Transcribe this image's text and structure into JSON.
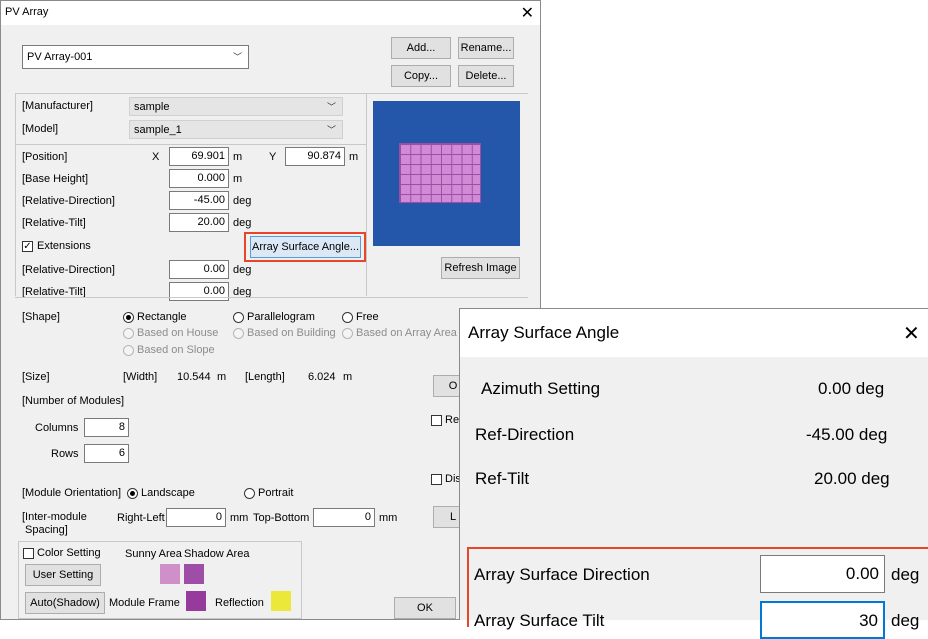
{
  "window": {
    "title": "PV Array",
    "close": "✕"
  },
  "array_select": {
    "value": "PV Array-001"
  },
  "buttons": {
    "add": "Add...",
    "rename": "Rename...",
    "copy": "Copy...",
    "delete": "Delete...",
    "array_surface_angle": "Array Surface Angle...",
    "refresh_image": "Refresh Image",
    "user_setting": "User Setting",
    "auto_shadow": "Auto(Shadow)",
    "ok": "OK",
    "o_partial": "O",
    "l_partial": "L"
  },
  "manufacturer": {
    "label": "[Manufacturer]",
    "value": "sample"
  },
  "model": {
    "label": "[Model]",
    "value": "sample_1"
  },
  "position": {
    "label": "[Position]",
    "x_label": "X",
    "x_value": "69.901",
    "x_unit": "m",
    "y_label": "Y",
    "y_value": "90.874",
    "y_unit": "m"
  },
  "base_height": {
    "label": "[Base Height]",
    "value": "0.000",
    "unit": "m"
  },
  "rel_direction": {
    "label": "[Relative-Direction]",
    "value": "-45.00",
    "unit": "deg"
  },
  "rel_tilt": {
    "label": "[Relative-Tilt]",
    "value": "20.00",
    "unit": "deg"
  },
  "extensions": {
    "label": "Extensions",
    "checked": true
  },
  "ext_rel_direction": {
    "label": "[Relative-Direction]",
    "value": "0.00",
    "unit": "deg"
  },
  "ext_rel_tilt": {
    "label": "[Relative-Tilt]",
    "value": "0.00",
    "unit": "deg"
  },
  "preview_colors": {
    "bg": "#2457a9",
    "module": "#d28ad6",
    "grid": "#9a4ea4"
  },
  "shape": {
    "label": "[Shape]",
    "rectangle": "Rectangle",
    "parallelogram": "Parallelogram",
    "free": "Free",
    "house": "Based on House",
    "building": "Based on Building",
    "array_area": "Based on Array Area",
    "slope": "Based on Slope"
  },
  "size": {
    "label": "[Size]",
    "width_label": "[Width]",
    "width_value": "10.544",
    "width_unit": "m",
    "length_label": "[Length]",
    "length_value": "6.024",
    "length_unit": "m"
  },
  "modules": {
    "label": "[Number of Modules]",
    "columns_label": "Columns",
    "columns_value": "8",
    "rows_label": "Rows",
    "rows_value": "6"
  },
  "partial_checks": {
    "ref": "Ref",
    "dis": "Dis"
  },
  "orientation": {
    "label": "[Module Orientation]",
    "landscape": "Landscape",
    "portrait": "Portrait"
  },
  "spacing": {
    "label_line1": "[Inter-module",
    "label_line2": "Spacing]",
    "rl_label": "Right-Left",
    "rl_value": "0",
    "rl_unit": "mm",
    "tb_label": "Top-Bottom",
    "tb_value": "0",
    "tb_unit": "mm"
  },
  "color": {
    "setting_label": "Color Setting",
    "sunny": "Sunny Area",
    "shadow": "Shadow Area",
    "frame": "Module Frame",
    "reflection": "Reflection",
    "sunny_color": "#cf8fc9",
    "shadow_color": "#9e4ea6",
    "frame_color": "#963b9b",
    "reflection_color": "#ebe83a"
  },
  "surface_panel": {
    "title": "Array Surface Angle",
    "close": "✕",
    "azimuth_label": "Azimuth Setting",
    "azimuth_value": "0.00 deg",
    "ref_dir_label": "Ref-Direction",
    "ref_dir_value": "-45.00 deg",
    "ref_tilt_label": "Ref-Tilt",
    "ref_tilt_value": "20.00 deg",
    "surf_dir_label": "Array Surface Direction",
    "surf_dir_value": "0.00",
    "surf_dir_unit": "deg",
    "surf_tilt_label": "Array Surface Tilt",
    "surf_tilt_value": "30",
    "surf_tilt_unit": "deg"
  },
  "highlight_color": "#e8452b"
}
